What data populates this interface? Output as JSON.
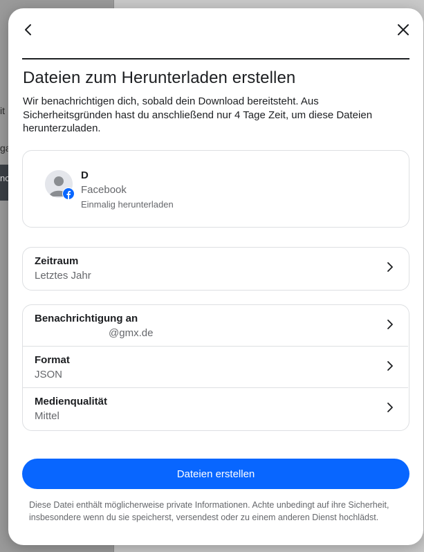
{
  "background": {
    "snippets": [
      "it",
      "ga",
      "nc"
    ]
  },
  "modal": {
    "title": "Dateien zum Herunterladen erstellen",
    "description": "Wir benachrichtigen dich, sobald dein Download bereitsteht. Aus Sicherheitsgründen hast du anschließend nur 4 Tage Zeit, um diese Dateien herunterzuladen.",
    "icons": {
      "back": "chevron-left-icon",
      "close": "close-icon"
    }
  },
  "account": {
    "name": "D",
    "platform": "Facebook",
    "subtitle": "Einmalig herunterladen",
    "badge_icon": "facebook-logo-icon"
  },
  "date_range": {
    "label": "Zeitraum",
    "value": "Letztes Jahr"
  },
  "settings": [
    {
      "label": "Benachrichtigung an",
      "value": "@gmx.de"
    },
    {
      "label": "Format",
      "value": "JSON"
    },
    {
      "label": "Medienqualität",
      "value": "Mittel"
    }
  ],
  "primary_button": {
    "label": "Dateien erstellen"
  },
  "disclaimer": "Diese Datei enthält möglicherweise private Informationen. Achte unbedingt auf ihre Sicherheit, insbesondere wenn du sie speicherst, versendest oder zu einem anderen Dienst hochlädst.",
  "colors": {
    "accent": "#0866ff",
    "text_primary": "#1c1e21",
    "text_secondary": "#65676b",
    "border": "#dddfe2"
  }
}
